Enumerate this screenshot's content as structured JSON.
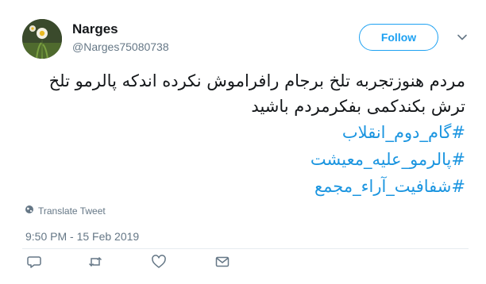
{
  "user": {
    "name": "Narges",
    "handle": "@Narges75080738"
  },
  "follow_button": {
    "label": "Follow"
  },
  "tweet": {
    "text": "مردم هنوزتجربه تلخ برجام رافراموش نکرده اندکه پالرمو تلخ ترش بکندکمی بفکرمردم باشید",
    "hashtags": [
      "#گام_دوم_انقلاب",
      "#پالرمو_علیه_معیشت",
      "#شفافیت_آراء_مجمع"
    ]
  },
  "translate_label": "Translate Tweet",
  "timestamp": "9:50 PM - 15 Feb 2019",
  "actions": [
    "reply-icon",
    "retweet-icon",
    "like-icon",
    "direct-message-icon"
  ],
  "colors": {
    "accent": "#1da1f2",
    "hashtag": "#1b95e0",
    "secondary_text": "#657786",
    "divider": "#e6ecf0"
  }
}
